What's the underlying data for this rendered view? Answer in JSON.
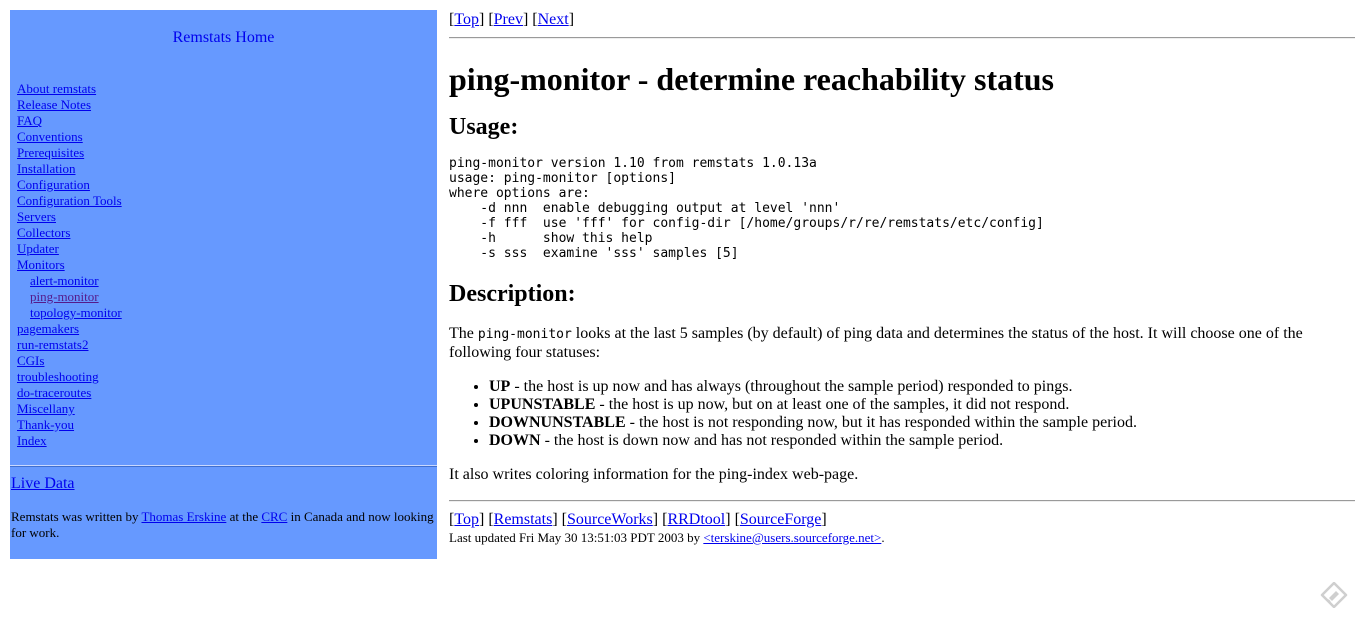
{
  "sidebar": {
    "home": "Remstats Home",
    "nav": [
      {
        "label": "About remstats",
        "indent": false,
        "current": false
      },
      {
        "label": "Release Notes",
        "indent": false,
        "current": false
      },
      {
        "label": "FAQ",
        "indent": false,
        "current": false
      },
      {
        "label": "Conventions",
        "indent": false,
        "current": false
      },
      {
        "label": "Prerequisites",
        "indent": false,
        "current": false
      },
      {
        "label": "Installation",
        "indent": false,
        "current": false
      },
      {
        "label": "Configuration",
        "indent": false,
        "current": false
      },
      {
        "label": "Configuration Tools",
        "indent": false,
        "current": false
      },
      {
        "label": "Servers",
        "indent": false,
        "current": false
      },
      {
        "label": "Collectors",
        "indent": false,
        "current": false
      },
      {
        "label": "Updater",
        "indent": false,
        "current": false
      },
      {
        "label": "Monitors",
        "indent": false,
        "current": false
      },
      {
        "label": "alert-monitor",
        "indent": true,
        "current": false
      },
      {
        "label": "ping-monitor",
        "indent": true,
        "current": true
      },
      {
        "label": "topology-monitor",
        "indent": true,
        "current": false
      },
      {
        "label": "pagemakers",
        "indent": false,
        "current": false
      },
      {
        "label": "run-remstats2",
        "indent": false,
        "current": false
      },
      {
        "label": "CGIs",
        "indent": false,
        "current": false
      },
      {
        "label": "troubleshooting",
        "indent": false,
        "current": false
      },
      {
        "label": "do-traceroutes",
        "indent": false,
        "current": false
      },
      {
        "label": "Miscellany",
        "indent": false,
        "current": false
      },
      {
        "label": "Thank-you",
        "indent": false,
        "current": false
      },
      {
        "label": "Index",
        "indent": false,
        "current": false
      }
    ],
    "live_data": "Live Data",
    "credits": {
      "prefix": "Remstats was written by ",
      "author": "Thomas Erskine",
      "mid": " at the ",
      "org": "CRC",
      "suffix": " in Canada and now looking for work."
    }
  },
  "top_nav": [
    {
      "text": "Top"
    },
    {
      "text": "Prev"
    },
    {
      "text": "Next"
    }
  ],
  "page": {
    "title": "ping-monitor - determine reachability status",
    "usage_heading": "Usage:",
    "usage_text": "ping-monitor version 1.10 from remstats 1.0.13a\nusage: ping-monitor [options]\nwhere options are:\n    -d nnn  enable debugging output at level 'nnn'\n    -f fff  use 'fff' for config-dir [/home/groups/r/re/remstats/etc/config]\n    -h      show this help\n    -s sss  examine 'sss' samples [5]",
    "description_heading": "Description:",
    "desc_prefix": "The ",
    "desc_code": "ping-monitor",
    "desc_rest": " looks at the last 5 samples (by default) of ping data and determines the status of the host. It will choose one of the following four statuses:",
    "statuses": [
      {
        "term": "UP",
        "text": " - the host is up now and has always (throughout the sample period) responded to pings."
      },
      {
        "term": "UPUNSTABLE",
        "text": " - the host is up now, but on at least one of the samples, it did not respond."
      },
      {
        "term": "DOWNUNSTABLE",
        "text": " - the host is not responding now, but it has responded within the sample period."
      },
      {
        "term": "DOWN",
        "text": " - the host is down now and has not responded within the sample period."
      }
    ],
    "closing": "It also writes coloring information for the ping-index web-page."
  },
  "footer": {
    "links": [
      {
        "text": "Top"
      },
      {
        "text": "Remstats"
      },
      {
        "text": "SourceWorks"
      },
      {
        "text": "RRDtool"
      },
      {
        "text": "SourceForge"
      }
    ],
    "updated_prefix": "Last updated Fri May 30 13:51:03 PDT 2003 by ",
    "email": "<terskine@users.sourceforge.net>",
    "updated_suffix": "."
  },
  "corner_icon": "pen-nib-icon"
}
